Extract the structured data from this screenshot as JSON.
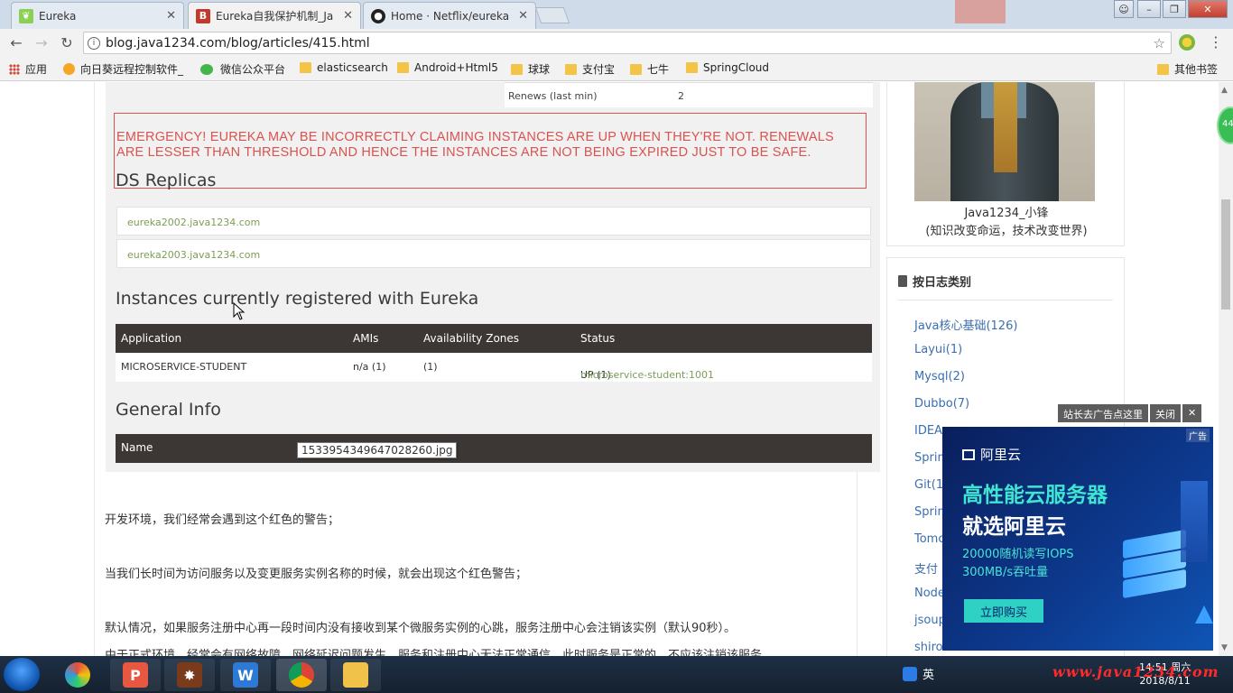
{
  "browser": {
    "tabs": [
      {
        "label": "Eureka",
        "favicon": "leaf-icon",
        "active": false
      },
      {
        "label": "Eureka自我保护机制_Ja",
        "favicon": "b-icon",
        "active": true
      },
      {
        "label": "Home · Netflix/eureka",
        "favicon": "github-icon",
        "active": false
      }
    ],
    "url": "blog.java1234.com/blog/articles/415.html",
    "bookmarks": [
      {
        "label": "应用",
        "icon": "apps-icon"
      },
      {
        "label": "向日葵远程控制软件_",
        "icon": "sunflower-icon"
      },
      {
        "label": "微信公众平台",
        "icon": "wechat-icon"
      },
      {
        "label": "elasticsearch",
        "icon": "folder-icon"
      },
      {
        "label": "Android+Html5",
        "icon": "folder-icon"
      },
      {
        "label": "球球",
        "icon": "folder-icon"
      },
      {
        "label": "支付宝",
        "icon": "folder-icon"
      },
      {
        "label": "七牛",
        "icon": "folder-icon"
      },
      {
        "label": "SpringCloud",
        "icon": "folder-icon"
      }
    ],
    "other_bookmarks": "其他书签"
  },
  "screenshot": {
    "renews_label": "Renews (last min)",
    "renews_value": "2",
    "warning": "EMERGENCY! EUREKA MAY BE INCORRECTLY CLAIMING INSTANCES ARE UP WHEN THEY'RE NOT. RENEWALS ARE LESSER THAN THRESHOLD AND HENCE THE INSTANCES ARE NOT BEING EXPIRED JUST TO BE SAFE.",
    "ds_replicas_title": "DS Replicas",
    "replicas": [
      "eureka2002.java1234.com",
      "eureka2003.java1234.com"
    ],
    "instances_title": "Instances currently registered with Eureka",
    "instances_headers": [
      "Application",
      "AMIs",
      "Availability Zones",
      "Status"
    ],
    "instance_row": {
      "application": "MICROSERVICE-STUDENT",
      "amis": "n/a (1)",
      "zones": "(1)",
      "status": "UP (1) - ",
      "status_link": "microservice-student:1001"
    },
    "general_title": "General Info",
    "general_header": "Name",
    "tooltip": "1533954349647028260.jpg"
  },
  "article": {
    "paragraphs": [
      "开发环境，我们经常会遇到这个红色的警告；",
      "当我们长时间为访问服务以及变更服务实例名称的时候，就会出现这个红色警告；",
      "默认情况，如果服务注册中心再一段时间内没有接收到某个微服务实例的心跳，服务注册中心会注销该实例（默认90秒）。",
      "由于正式环境，经常会有网络故障，网络延迟问题发生，服务和注册中心无法正常通信，此时服务是正常的，不应该注销该服务，"
    ]
  },
  "sidebar": {
    "profile_name": "Java1234_小锋",
    "profile_motto": "(知识改变命运，技术改变世界)",
    "category_title": "按日志类别",
    "categories": [
      "Java核心基础(126)",
      "Layui(1)",
      "Mysql(2)",
      "Dubbo(7)",
      "IDEA",
      "Sprin",
      "Git(1",
      "Sprin",
      "Tomc",
      "支付",
      "Node",
      "jsoup",
      "shiro"
    ]
  },
  "ad": {
    "bar_link": "站长去广告点这里",
    "bar_close": "关闭",
    "ad_tag": "广告",
    "brand": "阿里云",
    "headline1": "高性能云服务器",
    "headline2": "就选阿里云",
    "line1": "20000随机读写IOPS",
    "line2": "300MB/s吞吐量",
    "button": "立即购买"
  },
  "float_badge": "44",
  "taskbar": {
    "ime": "英",
    "time": "14:51 周六",
    "date": "2018/8/11",
    "watermark": "www.java1234.com"
  },
  "colors": {
    "warning_red": "#d9534f",
    "table_header": "#3c3734",
    "link_green": "#7d9e55",
    "category_link": "#3a6fb0"
  }
}
